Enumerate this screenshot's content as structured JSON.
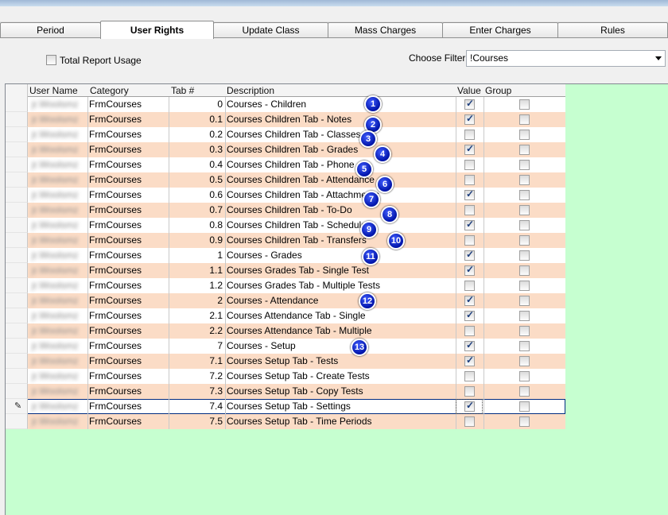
{
  "tabs": [
    "Period",
    "User Rights",
    "Update Class",
    "Mass Charges",
    "Enter Charges",
    "Rules"
  ],
  "active_tab": "User Rights",
  "toolbar": {
    "total_report_usage_label": "Total Report Usage",
    "total_report_usage_checked": false,
    "choose_filter_label": "Choose Filter",
    "filter_value": "!Courses"
  },
  "grid": {
    "columns": [
      "User Name",
      "Category",
      "Tab #",
      "Description",
      "Value",
      "Group"
    ],
    "rows": [
      {
        "user": "jr.Woolsmz",
        "category": "FrmCourses",
        "tab": "0",
        "description": "Courses - Children",
        "value": true,
        "group": false
      },
      {
        "user": "jr.Woolsmz",
        "category": "FrmCourses",
        "tab": "0.1",
        "description": "Courses Children Tab - Notes",
        "value": true,
        "group": false
      },
      {
        "user": "jr.Woolsmz",
        "category": "FrmCourses",
        "tab": "0.2",
        "description": "Courses Children Tab - Classes",
        "value": false,
        "group": false
      },
      {
        "user": "jr.Woolsmz",
        "category": "FrmCourses",
        "tab": "0.3",
        "description": "Courses Children Tab - Grades",
        "value": true,
        "group": false
      },
      {
        "user": "jr.Woolsmz",
        "category": "FrmCourses",
        "tab": "0.4",
        "description": "Courses Children Tab - Phone",
        "value": false,
        "group": false
      },
      {
        "user": "jr.Woolsmz",
        "category": "FrmCourses",
        "tab": "0.5",
        "description": "Courses Children Tab - Attendance",
        "value": false,
        "group": false
      },
      {
        "user": "jr.Woolsmz",
        "category": "FrmCourses",
        "tab": "0.6",
        "description": "Courses Children Tab - Attachments",
        "value": true,
        "group": false
      },
      {
        "user": "jr.Woolsmz",
        "category": "FrmCourses",
        "tab": "0.7",
        "description": "Courses Children Tab - To-Do",
        "value": false,
        "group": false
      },
      {
        "user": "jr.Woolsmz",
        "category": "FrmCourses",
        "tab": "0.8",
        "description": "Courses Children Tab - Schedule",
        "value": true,
        "group": false
      },
      {
        "user": "jr.Woolsmz",
        "category": "FrmCourses",
        "tab": "0.9",
        "description": "Courses Children Tab - Transfers",
        "value": false,
        "group": false
      },
      {
        "user": "jr.Woolsmz",
        "category": "FrmCourses",
        "tab": "1",
        "description": "Courses - Grades",
        "value": true,
        "group": false
      },
      {
        "user": "jr.Woolsmz",
        "category": "FrmCourses",
        "tab": "1.1",
        "description": "Courses Grades Tab - Single Test",
        "value": true,
        "group": false
      },
      {
        "user": "jr.Woolsmz",
        "category": "FrmCourses",
        "tab": "1.2",
        "description": "Courses Grades Tab - Multiple Tests",
        "value": false,
        "group": false
      },
      {
        "user": "jr.Woolsmz",
        "category": "FrmCourses",
        "tab": "2",
        "description": "Courses - Attendance",
        "value": true,
        "group": false
      },
      {
        "user": "jr.Woolsmz",
        "category": "FrmCourses",
        "tab": "2.1",
        "description": "Courses Attendance Tab - Single",
        "value": true,
        "group": false
      },
      {
        "user": "jr.Woolsmz",
        "category": "FrmCourses",
        "tab": "2.2",
        "description": "Courses Attendance Tab - Multiple",
        "value": false,
        "group": false
      },
      {
        "user": "jr.Woolsmz",
        "category": "FrmCourses",
        "tab": "7",
        "description": "Courses - Setup",
        "value": true,
        "group": false
      },
      {
        "user": "jr.Woolsmz",
        "category": "FrmCourses",
        "tab": "7.1",
        "description": "Courses Setup Tab - Tests",
        "value": true,
        "group": false
      },
      {
        "user": "jr.Woolsmz",
        "category": "FrmCourses",
        "tab": "7.2",
        "description": "Courses Setup Tab - Create Tests",
        "value": false,
        "group": false
      },
      {
        "user": "jr.Woolsmz",
        "category": "FrmCourses",
        "tab": "7.3",
        "description": "Courses Setup Tab - Copy Tests",
        "value": false,
        "group": false
      },
      {
        "user": "jr.Woolsmz",
        "category": "FrmCourses",
        "tab": "7.4",
        "description": "Courses Setup Tab - Settings",
        "value": true,
        "group": false
      },
      {
        "user": "jr.Woolsmz",
        "category": "FrmCourses",
        "tab": "7.5",
        "description": "Courses Setup Tab - Time Periods",
        "value": false,
        "group": false
      }
    ],
    "current_row": 20
  },
  "badges": [
    "1",
    "2",
    "3",
    "4",
    "5",
    "6",
    "7",
    "8",
    "9",
    "10",
    "11",
    "12",
    "13"
  ],
  "colors": {
    "grid_background": "#c6ffd0",
    "alt_row": "#fbdcc6",
    "badge": "#0020d0"
  }
}
